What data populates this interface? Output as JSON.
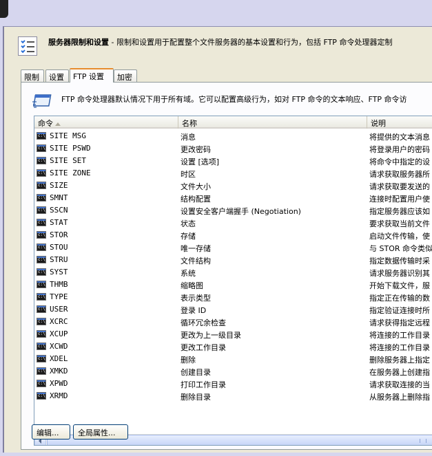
{
  "header": {
    "title": "服务器限制和设置",
    "subtitle": " - 限制和设置用于配置整个文件服务器的基本设置和行为，包括 FTP 命令处理器定制"
  },
  "tabs": [
    {
      "label": "限制",
      "active": false
    },
    {
      "label": "设置",
      "active": false
    },
    {
      "label": "FTP 设置",
      "active": true
    },
    {
      "label": "加密",
      "active": false
    }
  ],
  "panel": {
    "description": "FTP 命令处理器默认情况下用于所有域。它可以配置高级行为，如对 FTP 命令的文本响应、FTP 命令访"
  },
  "list": {
    "columns": [
      {
        "label": "命令",
        "sorted": "ascending"
      },
      {
        "label": "名称"
      },
      {
        "label": "说明"
      }
    ],
    "rows": [
      {
        "cmd": "SITE MSG",
        "name": "消息",
        "desc": "将提供的文本消息"
      },
      {
        "cmd": "SITE PSWD",
        "name": "更改密码",
        "desc": "将登录用户的密码"
      },
      {
        "cmd": "SITE SET",
        "name": "设置 [选项]",
        "desc": "将命令中指定的设"
      },
      {
        "cmd": "SITE ZONE",
        "name": "时区",
        "desc": "请求获取服务器所"
      },
      {
        "cmd": "SIZE",
        "name": "文件大小",
        "desc": "请求获取要发送的"
      },
      {
        "cmd": "SMNT",
        "name": "结构配置",
        "desc": "连接时配置用户使"
      },
      {
        "cmd": "SSCN",
        "name": "设置安全客户端握手 (Negotiation)",
        "desc": "指定服务器应该如"
      },
      {
        "cmd": "STAT",
        "name": "状态",
        "desc": "要求获取当前文件"
      },
      {
        "cmd": "STOR",
        "name": "存储",
        "desc": "启动文件传输，使"
      },
      {
        "cmd": "STOU",
        "name": "唯一存储",
        "desc": "与 STOR 命令类似"
      },
      {
        "cmd": "STRU",
        "name": "文件结构",
        "desc": "指定数据传输时采"
      },
      {
        "cmd": "SYST",
        "name": "系统",
        "desc": "请求服务器识别其"
      },
      {
        "cmd": "THMB",
        "name": "缩略图",
        "desc": "开始下载文件，服"
      },
      {
        "cmd": "TYPE",
        "name": "表示类型",
        "desc": "指定正在传输的数"
      },
      {
        "cmd": "USER",
        "name": "登录 ID",
        "desc": "指定验证连接时所"
      },
      {
        "cmd": "XCRC",
        "name": "循环冗余检查",
        "desc": "请求获得指定远程"
      },
      {
        "cmd": "XCUP",
        "name": "更改为上一级目录",
        "desc": "将连接的工作目录"
      },
      {
        "cmd": "XCWD",
        "name": "更改工作目录",
        "desc": "将连接的工作目录"
      },
      {
        "cmd": "XDEL",
        "name": "删除",
        "desc": "删除服务器上指定"
      },
      {
        "cmd": "XMKD",
        "name": "创建目录",
        "desc": "在服务器上创建指"
      },
      {
        "cmd": "XPWD",
        "name": "打印工作目录",
        "desc": "请求获取连接的当"
      },
      {
        "cmd": "XRMD",
        "name": "删除目录",
        "desc": "从服务器上删除指"
      }
    ]
  },
  "buttons": {
    "edit": "编辑...",
    "global_properties": "全局属性..."
  },
  "colors": {
    "background": "#d6d6ee",
    "dialog": "#ece9d8",
    "active_tab_accent": "#e68b2c"
  }
}
